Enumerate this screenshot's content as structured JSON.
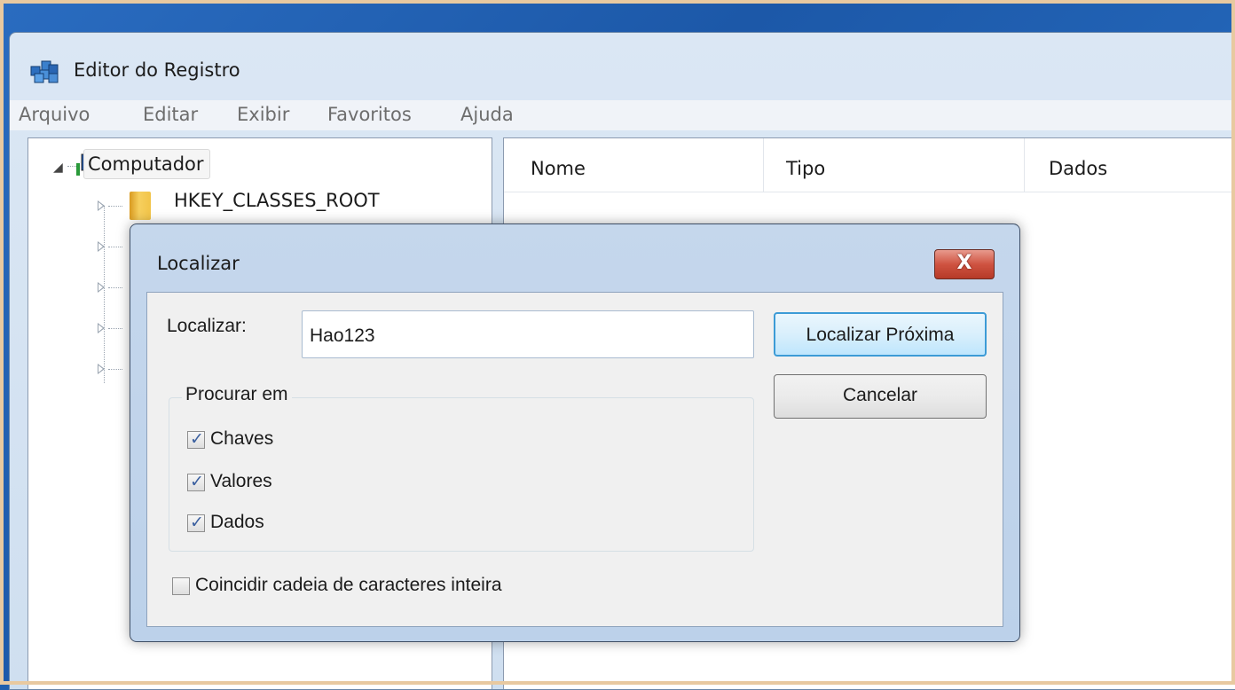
{
  "window": {
    "title": "Editor do Registro",
    "icon": "registry-editor-icon"
  },
  "menu": {
    "items": [
      "Arquivo",
      "Editar",
      "Exibir",
      "Favoritos",
      "Ajuda"
    ]
  },
  "tree": {
    "root": "Computador",
    "root_icon": "computer-icon",
    "first_key": "HKEY_CLASSES_ROOT",
    "folder_icon": "folder-icon"
  },
  "list": {
    "columns": [
      "Nome",
      "Tipo",
      "Dados"
    ]
  },
  "dialog": {
    "title": "Localizar",
    "find_label": "Localizar:",
    "find_value": "Hao123",
    "find_next_label": "Localizar Próxima",
    "cancel_label": "Cancelar",
    "close_glyph": "X",
    "group_label": "Procurar em",
    "options": [
      {
        "label": "Chaves",
        "checked": true
      },
      {
        "label": "Valores",
        "checked": true
      },
      {
        "label": "Dados",
        "checked": true
      }
    ],
    "match_whole": {
      "label": "Coincidir cadeia de caracteres inteira",
      "checked": false
    }
  },
  "colors": {
    "desktop": "#1f5fae",
    "find_next_border": "#3c9bd6",
    "close_button": "#cf5341"
  }
}
